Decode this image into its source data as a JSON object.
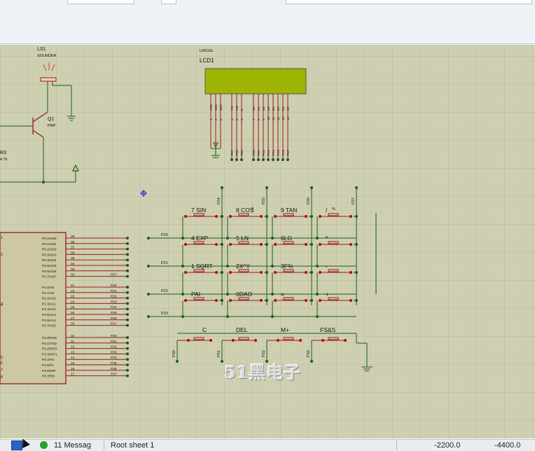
{
  "speaker": {
    "ref": "LS1",
    "value": "SOUNDER"
  },
  "transistor": {
    "ref": "Q1",
    "value": "PNP"
  },
  "resistor": {
    "ref": "R3",
    "value": "4.7k"
  },
  "lcd": {
    "part": "LM016L",
    "ref": "LCD1",
    "pins": [
      "VSS",
      "VDD",
      "VEE",
      "RS",
      "RW",
      "E",
      "D0",
      "D1",
      "D2",
      "D3",
      "D4",
      "D5",
      "D6",
      "D7"
    ],
    "pin_numbers": [
      "1",
      "2",
      "3",
      "4",
      "5",
      "6",
      "7",
      "8",
      "9",
      "10",
      "11",
      "12",
      "13",
      "14"
    ],
    "nets": [
      "P27",
      "P26",
      "P25",
      "P10",
      "P11",
      "P12",
      "P13",
      "P14",
      "P15",
      "P16",
      "P17"
    ]
  },
  "keypad": {
    "rows": [
      [
        "7 SIN",
        "8 COS",
        "9 TAN",
        "/"
      ],
      [
        "4 EXP",
        "5 LN",
        "6LG",
        "*"
      ],
      [
        "1 SQRT",
        "2X^Y",
        "3F%",
        "-"
      ],
      [
        "PAI",
        "0DAO",
        "=",
        "+"
      ]
    ],
    "key_marks": {
      "cos": "2",
      "div": "%"
    },
    "func_keys": [
      "C",
      "DEL",
      "M+",
      "FS&S"
    ],
    "row_nets": [
      "P20",
      "P21",
      "P22",
      "P23"
    ],
    "col_nets": [
      "P24",
      "P25",
      "P26",
      "P27"
    ],
    "func_nets": [
      "P30",
      "P31",
      "P32",
      "P33"
    ]
  },
  "mcu": {
    "left_labels": [
      "1",
      "2",
      "3",
      "4",
      "5",
      "6",
      "7",
      "8"
    ],
    "pins": [
      {
        "name": "P0.0/AD0",
        "num": "39",
        "net": ""
      },
      {
        "name": "P0.1/AD1",
        "num": "38",
        "net": ""
      },
      {
        "name": "P0.2/AD2",
        "num": "37",
        "net": ""
      },
      {
        "name": "P0.3/AD3",
        "num": "36",
        "net": ""
      },
      {
        "name": "P0.4/AD4",
        "num": "35",
        "net": ""
      },
      {
        "name": "P0.5/AD5",
        "num": "34",
        "net": ""
      },
      {
        "name": "P0.6/AD6",
        "num": "33",
        "net": ""
      },
      {
        "name": "P0.7/AD7",
        "num": "32",
        "net": "P07"
      },
      {
        "name": "P2.0/A8",
        "num": "21",
        "net": "P20"
      },
      {
        "name": "P2.1/A9",
        "num": "22",
        "net": "P21"
      },
      {
        "name": "P2.2/A10",
        "num": "23",
        "net": "P22"
      },
      {
        "name": "P2.3/A11",
        "num": "24",
        "net": "P23"
      },
      {
        "name": "P2.4/A12",
        "num": "25",
        "net": "P24"
      },
      {
        "name": "P2.5/A13",
        "num": "26",
        "net": "P25"
      },
      {
        "name": "P2.6/A14",
        "num": "27",
        "net": "P26"
      },
      {
        "name": "P2.7/A15",
        "num": "28",
        "net": "P27"
      },
      {
        "name": "P3.0/RXD",
        "num": "10",
        "net": "P30"
      },
      {
        "name": "P3.1/TXD",
        "num": "11",
        "net": "P31"
      },
      {
        "name": "P3.2/INT0",
        "num": "12",
        "net": "P32"
      },
      {
        "name": "P3.3/INT1",
        "num": "13",
        "net": "P33"
      },
      {
        "name": "P3.4/T0",
        "num": "14",
        "net": "P34"
      },
      {
        "name": "P3.5/T1",
        "num": "15",
        "net": "P35"
      },
      {
        "name": "P3.6/WR",
        "num": "16",
        "net": "P36"
      },
      {
        "name": "P3.7/RD",
        "num": "17",
        "net": "P37"
      }
    ]
  },
  "watermark": "51黑电子",
  "statusbar": {
    "messages": "11 Messag",
    "sheet": "Root sheet 1",
    "coord_x": "-2200.0",
    "coord_y": "-4400.0"
  },
  "colors": {
    "canvas_bg": "#cfcfb2",
    "grid": "#b9b99a",
    "wire": "#1a5c1a",
    "component": "#9b1b1b",
    "lcd_screen": "#9db400",
    "mcu_body": "#cdc7a3"
  },
  "icons": {
    "status_app": "window-icon",
    "status_messages": "info-circle-icon",
    "origin": "origin-marker-icon"
  }
}
